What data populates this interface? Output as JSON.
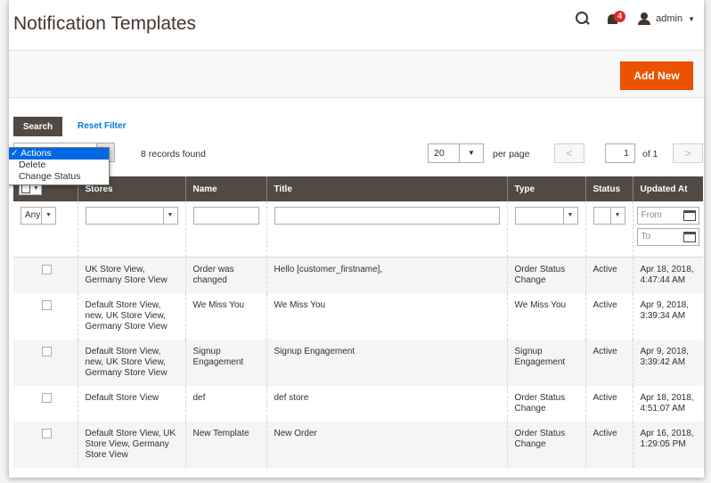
{
  "header": {
    "title": "Notification Templates",
    "notification_count": "4",
    "user": "admin"
  },
  "actionbar": {
    "add_new": "Add New"
  },
  "filters": {
    "search": "Search",
    "reset": "Reset Filter"
  },
  "mass_actions": {
    "options": [
      "Actions",
      "Delete",
      "Change Status"
    ],
    "selected": "Actions"
  },
  "records_found": "8 records found",
  "pager": {
    "per_page_value": "20",
    "per_page_label": "per page",
    "current_page": "1",
    "of_label": "of 1"
  },
  "grid": {
    "columns": [
      "Stores",
      "Name",
      "Title",
      "Type",
      "Status",
      "Updated At"
    ],
    "filter_any": "Any",
    "date_from": "From",
    "date_to": "To",
    "rows": [
      {
        "stores": "UK Store View,\nGermany Store View",
        "name": "Order was changed",
        "title": "Hello [customer_firstname],",
        "type": "Order Status Change",
        "status": "Active",
        "updated": "Apr 18, 2018, 4:47:44 AM"
      },
      {
        "stores": "Default Store View, new, UK Store View, Germany Store View",
        "name": "We Miss You",
        "title": "We Miss You",
        "type": "We Miss You",
        "status": "Active",
        "updated": "Apr 9, 2018, 3:39:34 AM"
      },
      {
        "stores": "Default Store View, new, UK Store View, Germany Store View",
        "name": "Signup Engagement",
        "title": "Signup Engagement",
        "type": "Signup Engagement",
        "status": "Active",
        "updated": "Apr 9, 2018, 3:39:42 AM"
      },
      {
        "stores": "Default Store View",
        "name": "def",
        "title": "def store",
        "type": "Order Status Change",
        "status": "Active",
        "updated": "Apr 18, 2018, 4:51:07 AM"
      },
      {
        "stores": "Default Store View, UK Store View, Germany Store View",
        "name": "New Template",
        "title": "New Order",
        "type": "Order Status Change",
        "status": "Active",
        "updated": "Apr 16, 2018, 1:29:05 PM"
      }
    ]
  }
}
